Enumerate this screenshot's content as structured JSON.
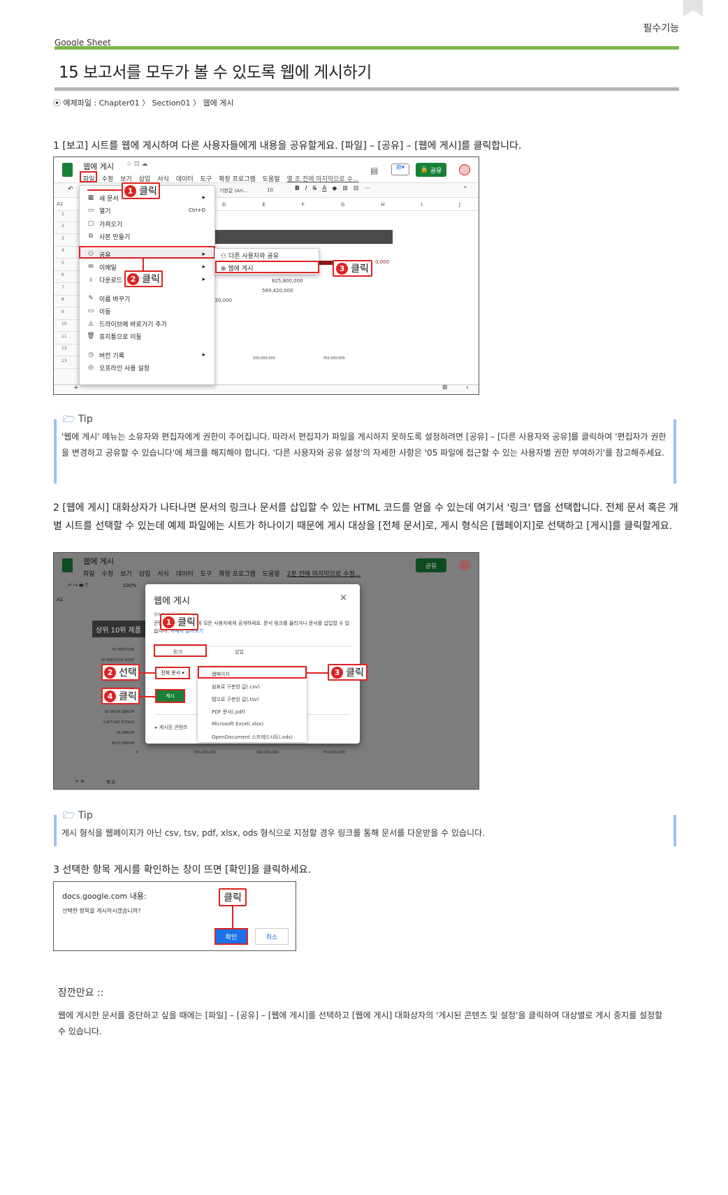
{
  "header": {
    "section_tag": "필수기능",
    "source": "Google Sheet",
    "title": "15 보고서를 모두가 볼 수 있도록 웹에 게시하기",
    "example_path": "예제파일 : Chapter01 〉 Section01 〉 웹에 게시"
  },
  "step1": {
    "text": "1 [보고] 시트를 웹에 게시하여 다른 사용자들에게 내용을 공유할게요. [파일] – [공유] – [웹에 게시]를 클릭합니다.",
    "doc_title": "웹에 게시",
    "menubar": [
      "파일",
      "수정",
      "보기",
      "삽입",
      "서식",
      "데이터",
      "도구",
      "확장 프로그램",
      "도움말"
    ],
    "last_edit": "몇 초 전에 마지막으로 수...",
    "share_label": "공유",
    "file_menu": [
      {
        "icon": "▦",
        "label": "새 문서",
        "shortcut": "▸"
      },
      {
        "icon": "▭",
        "label": "열기",
        "shortcut": "Ctrl+O"
      },
      {
        "icon": "▢",
        "label": "가져오기",
        "shortcut": ""
      },
      {
        "icon": "⧉",
        "label": "사본 만들기",
        "shortcut": ""
      },
      {
        "icon": "⚇",
        "label": "공유",
        "shortcut": "▸"
      },
      {
        "icon": "✉",
        "label": "이메일",
        "shortcut": "▸"
      },
      {
        "icon": "⤓",
        "label": "다운로드",
        "shortcut": "▸"
      },
      {
        "icon": "✎",
        "label": "이름 바꾸기",
        "shortcut": ""
      },
      {
        "icon": "▭",
        "label": "이동",
        "shortcut": ""
      },
      {
        "icon": "◬",
        "label": "드라이브에 바로가기 추가",
        "shortcut": ""
      },
      {
        "icon": "🗑",
        "label": "휴지통으로 이동",
        "shortcut": ""
      },
      {
        "icon": "◷",
        "label": "버전 기록",
        "shortcut": "▸"
      },
      {
        "icon": "◎",
        "label": "오프라인 사용 설정",
        "shortcut": ""
      }
    ],
    "share_submenu": [
      "다른 사용자와 공유",
      "웹에 게시"
    ],
    "cell_ref": "A1",
    "font_name": "기본값 (Ari...",
    "font_size": "10",
    "columns": [
      "D",
      "E",
      "F",
      "G",
      "H",
      "I",
      "J"
    ],
    "rows": [
      "1",
      "2",
      "3",
      "4",
      "5",
      "6",
      "7",
      "8",
      "9",
      "10",
      "11",
      "12",
      "13"
    ],
    "chart_values": [
      "625,800,000",
      "589,420,000",
      "95,620,000",
      "0,000",
      "00,00"
    ],
    "axis_ticks": [
      "500,000,000",
      "750,000,000"
    ],
    "callouts": {
      "c1": "클릭",
      "c2": "클릭",
      "c3": "클릭",
      "n1": "1",
      "n2": "2",
      "n3": "3"
    }
  },
  "tip1": {
    "title": "Tip",
    "text": "'웹에 게시' 메뉴는 소유자와 편집자에게 권한이 주어집니다. 따라서 편집자가 파일을 게시하지 못하도록 설정하려면 [공유] – [다른 사용자와 공유]를 클릭하여 '편집자가 권한을 변경하고 공유할 수 있습니다'에 체크를 해지해야 합니다. '다른 사용자와 공유 설정'의 자세한 사항은 '05 파일에 접근할 수 있는 사용자별 권한 부여하기'를 참고해주세요."
  },
  "step2": {
    "text": "2 [웹에 게시] 대화상자가 나타나면 문서의 링크나 문서를 삽입할 수 있는 HTML 코드를 얻을 수 있는데 여기서 '링크' 탭을 선택합니다. 전체 문서 혹은 개별 시트를 선택할 수 있는데 예제 파일에는 시트가 하나이기 때문에 게시 대상을 [전체 문서]로, 게시 형식은 [웹페이지]로 선택하고 [게시]를 클릭할게요.",
    "doc_title": "웹에 게시",
    "menubar": [
      "파일",
      "수정",
      "보기",
      "삽입",
      "서식",
      "데이터",
      "도구",
      "확장 프로그램",
      "도움말"
    ],
    "last_edit": "2분 전에 마지막으로 수정...",
    "share_label": "공유",
    "zoom": "100%",
    "cell_ref": "A1",
    "sheet_header": "상위 10위 제품",
    "product_labels": [
      "DI PRESTIGE",
      "DI PRESTIGE ROSE",
      "DI SNOW SERUM",
      "CAPTURE TOTALE",
      "DI SERUM",
      "RICH SERUM"
    ],
    "axis_ticks": [
      "0",
      "250,000,000",
      "500,000,000",
      "750,000,000"
    ],
    "sheet_tab": "보고",
    "dialog": {
      "title": "웹에 게시",
      "close": "×",
      "desc_top": "웹에 게시된 문서입니다.",
      "desc": "콘텐츠를 웹에 게시하여 모든 사용자에게 공개하세요. 문서 링크를 올리거나 문서를 삽입할 수 있습니다.",
      "learn_more": "자세히 알아보기",
      "tab_link": "링크",
      "tab_embed": "삽입",
      "scope": "전체 문서",
      "publish": "게시",
      "published_settings": "게시된 콘텐츠",
      "formats": [
        "웹페이지",
        "쉼표로 구분된 값(.csv)",
        "탭으로 구분된 값(.tsv)",
        "PDF 문서(.pdf)",
        "Microsoft Excel(.xlsx)",
        "OpenDocument 스프레드시트(.ods)"
      ]
    },
    "callouts": {
      "c1": "클릭",
      "c2": "선택",
      "c3": "클릭",
      "c4": "클릭",
      "n1": "1",
      "n2": "2",
      "n3": "3",
      "n4": "4"
    }
  },
  "tip2": {
    "title": "Tip",
    "text": "게시 형식을 웹페이지가 아닌 csv, tsv, pdf, xlsx, ods 형식으로 지정할 경우 링크를 통해 문서를 다운받을 수 있습니다."
  },
  "step3": {
    "text": "3 선택한 항목 게시를 확인하는 창이 뜨면 [확인]을 클릭하세요.",
    "origin": "docs.google.com 내용:",
    "question": "선택한 항목을 게시하시겠습니까?",
    "ok": "확인",
    "cancel": "취소",
    "callout": "클릭"
  },
  "note": {
    "title": "잠깐만요 ::",
    "text": "웹에 게시한 문서를 중단하고 싶을 때에는 [파일] – [공유] – [웹에 게시]를 선택하고 [웹에 게시] 대화상자의 '게시된 콘텐츠 및 설정'을 클릭하여 대상별로 게시 중지를 설정할 수 있습니다."
  },
  "colors": {
    "green": "#7ab648",
    "red": "#d22222",
    "sheets_green": "#188038",
    "tip_bar": "#9cc3f0",
    "blue_button": "#1a73e8"
  }
}
